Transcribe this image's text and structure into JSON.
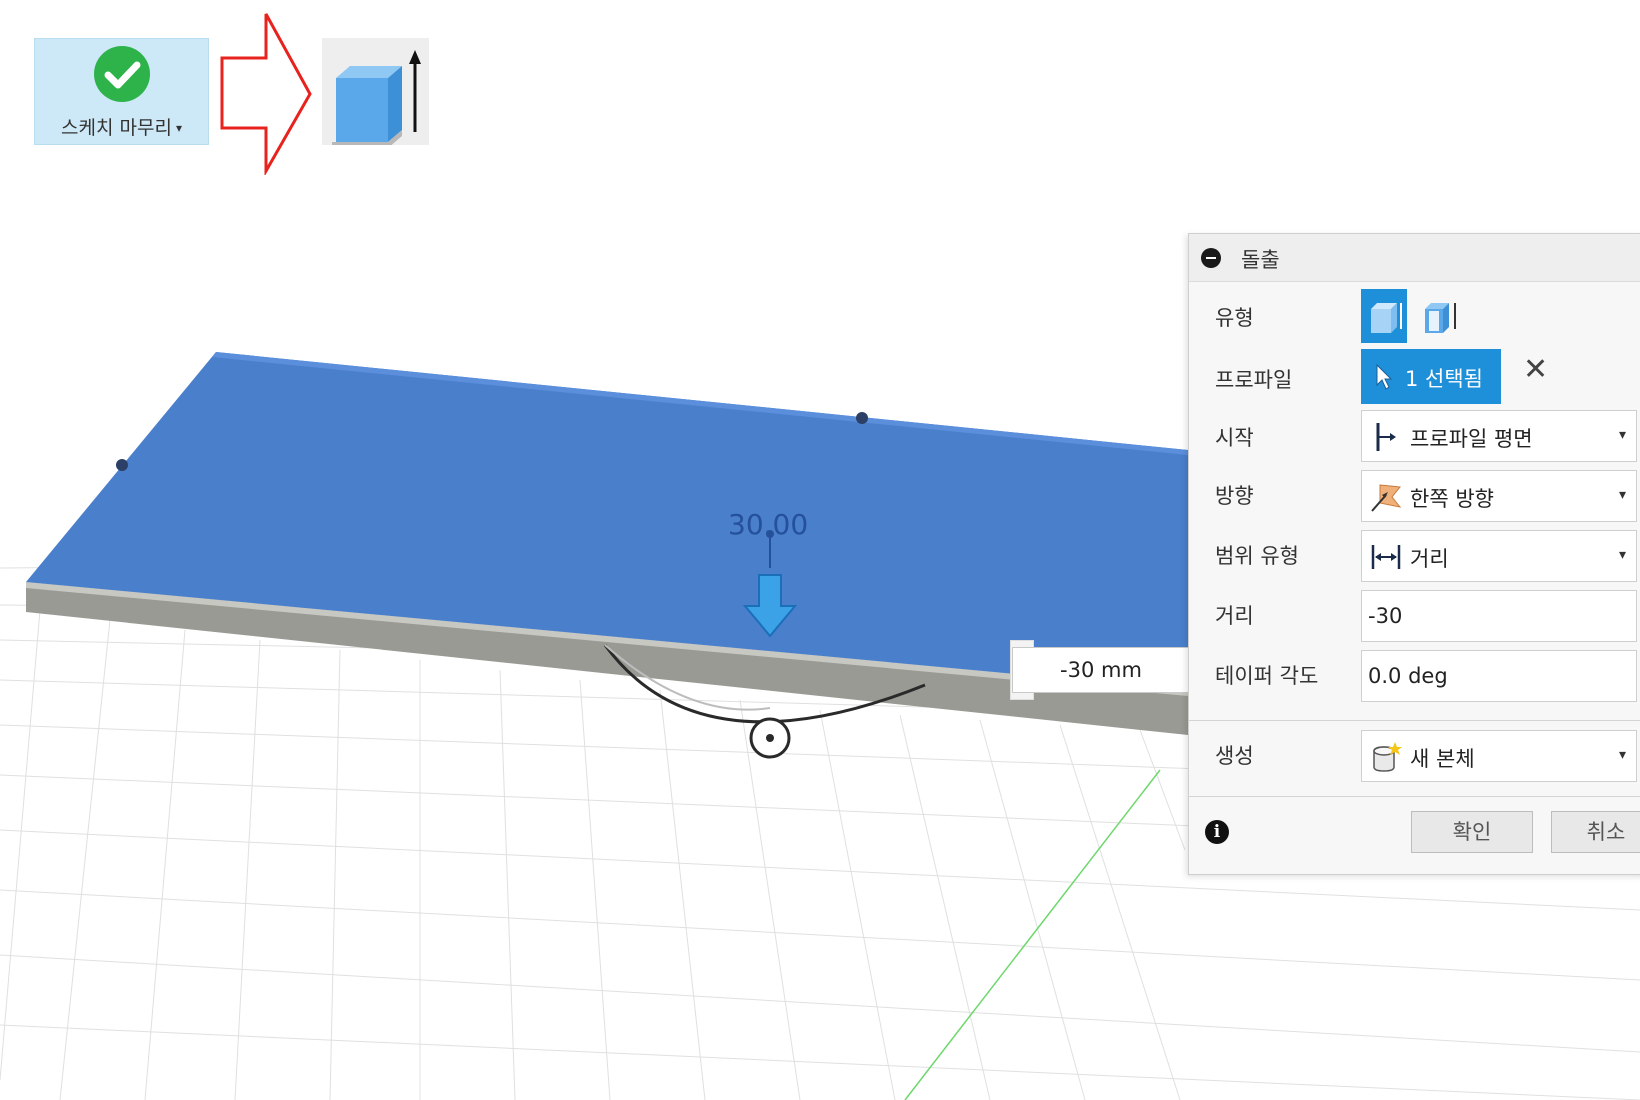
{
  "toolbar": {
    "finish_sketch": {
      "label": "스케치 마무리",
      "caret": "▾",
      "icon": "check-circle-icon",
      "color": "#2db34a"
    },
    "annotation_arrow_color": "#e8231e",
    "extrude": {
      "icon": "extrude-icon"
    }
  },
  "canvas": {
    "dimension_text": "30.00",
    "distance_input_value": "-30 mm",
    "sketch_plane_color": "#4a7fcc",
    "manipulator_arrow_color": "#2f9ae0",
    "grid_axis_color": "#6cd86c"
  },
  "panel": {
    "title": "돌출",
    "accent_color": "#1e8fd9",
    "rows": {
      "type": {
        "label": "유형"
      },
      "profile": {
        "label": "프로파일",
        "selection": "1 선택됨",
        "clear": "✕"
      },
      "start": {
        "label": "시작",
        "value": "프로파일 평면",
        "icon": "profile-plane-icon"
      },
      "direction": {
        "label": "방향",
        "value": "한쪽 방향",
        "icon": "one-side-direction-icon"
      },
      "extent_type": {
        "label": "범위 유형",
        "value": "거리",
        "icon": "distance-icon"
      },
      "distance": {
        "label": "거리",
        "value": "-30"
      },
      "taper_angle": {
        "label": "테이퍼 각도",
        "value": "0.0 deg"
      },
      "operation": {
        "label": "생성",
        "value": "새 본체",
        "icon": "new-body-icon"
      }
    },
    "footer": {
      "ok": "확인",
      "cancel": "취소"
    },
    "caret": "▾"
  }
}
